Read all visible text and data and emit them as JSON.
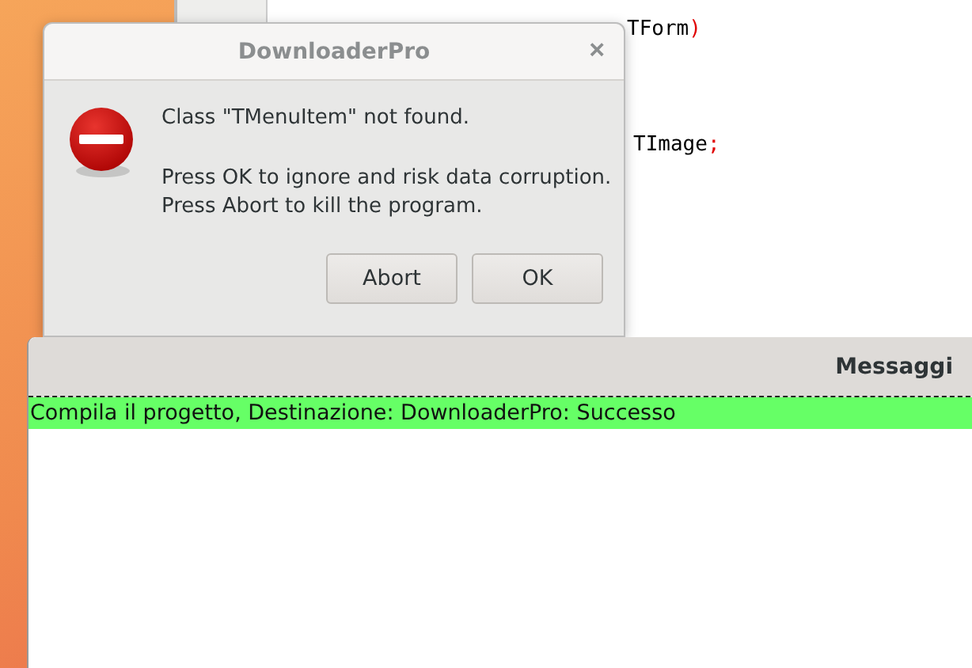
{
  "editor": {
    "code_lines": [
      {
        "tokens": [
          {
            "text": "TForm",
            "kind": "ident"
          },
          {
            "text": ")",
            "kind": "symbol"
          }
        ]
      },
      {
        "tokens": [
          {
            "text": "TImage",
            "kind": "ident"
          },
          {
            "text": ";",
            "kind": "symbol"
          }
        ]
      }
    ]
  },
  "dialog": {
    "title": "DownloaderPro",
    "close": "×",
    "message": "Class \"TMenuItem\" not found.",
    "details": [
      "Press OK to ignore and risk data corruption.",
      "Press Abort to kill the program."
    ],
    "buttons": [
      {
        "label": "Abort"
      },
      {
        "label": "OK"
      }
    ]
  },
  "messages_panel": {
    "title": "Messaggi",
    "rows": [
      {
        "text": "Compila il progetto, Destinazione: DownloaderPro: Successo",
        "color": "#66ff66"
      }
    ]
  }
}
